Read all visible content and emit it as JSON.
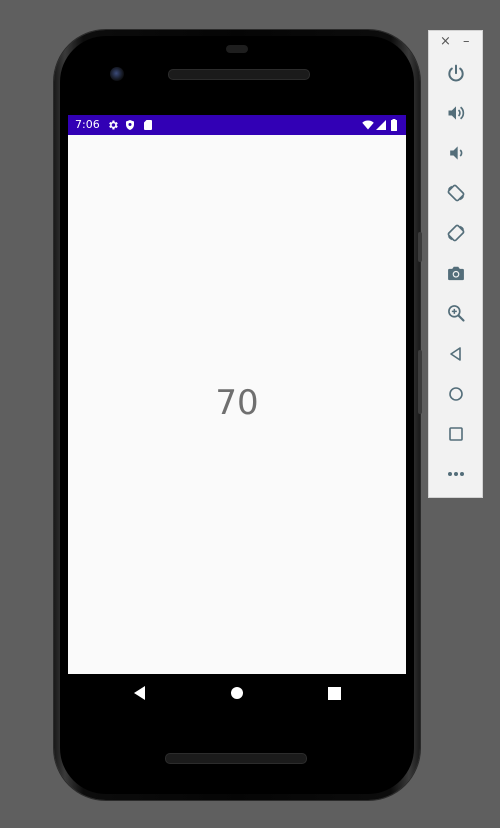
{
  "status_bar": {
    "time": "7:06",
    "left_icons": [
      "gear-icon",
      "shield-icon",
      "sd-card-icon"
    ],
    "right_icons": [
      "wifi-icon",
      "signal-icon",
      "battery-icon"
    ],
    "color": "#3200b5"
  },
  "app": {
    "value": "70"
  },
  "nav_bar": {
    "buttons": [
      "back-icon",
      "home-icon",
      "recents-icon"
    ]
  },
  "emulator_panel": {
    "close_label": "×",
    "minimize_label": "–",
    "controls": [
      "power-icon",
      "volume-up-icon",
      "volume-down-icon",
      "rotate-left-icon",
      "rotate-right-icon",
      "camera-icon",
      "zoom-icon",
      "back-icon",
      "home-icon",
      "overview-icon",
      "more-icon"
    ]
  }
}
